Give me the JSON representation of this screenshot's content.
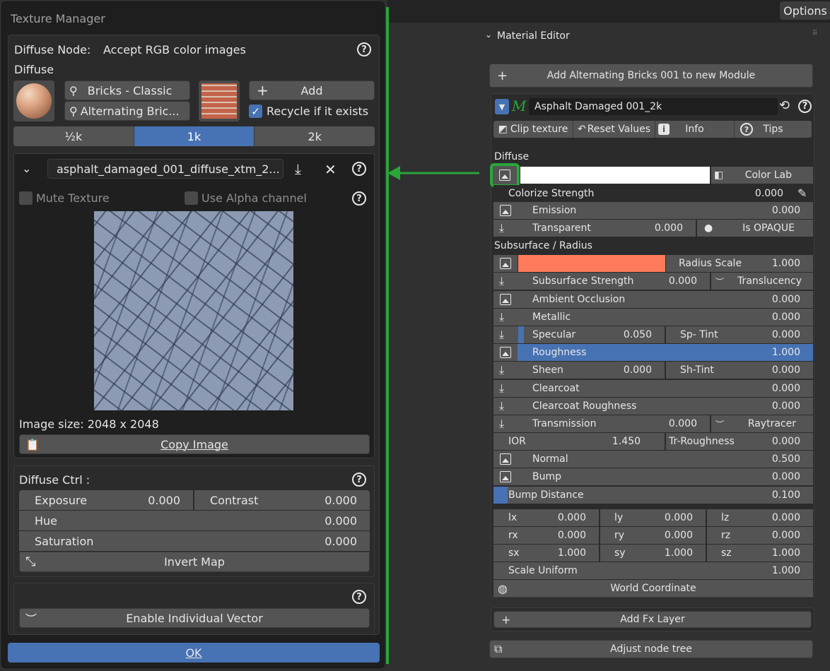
{
  "topbar": {
    "options_label": "Options"
  },
  "texture_manager": {
    "title": "Texture Manager",
    "diffuse_node_label": "Diffuse Node:",
    "diffuse_node_desc": "Accept RGB color images",
    "diffuse_label": "Diffuse",
    "preset_name": "Bricks - Classic",
    "preset_variant": "Alternating Bric...",
    "add_label": "Add",
    "recycle_label": "Recycle if it exists",
    "recycle_checked": true,
    "resolutions": [
      "½k",
      "1k",
      "2k"
    ],
    "selected_resolution": "1k",
    "file_name": "asphalt_damaged_001_diffuse_xtm_2...",
    "mute_label": "Mute Texture",
    "alpha_label": "Use Alpha channel",
    "image_size": "Image size: 2048 x 2048",
    "copy_label": "Copy Image",
    "ctrl_title": "Diffuse Ctrl :",
    "exposure_label": "Exposure",
    "exposure_value": "0.000",
    "contrast_label": "Contrast",
    "contrast_value": "0.000",
    "hue_label": "Hue",
    "hue_value": "0.000",
    "saturation_label": "Saturation",
    "saturation_value": "0.000",
    "invert_label": "Invert Map",
    "vector_label": "Enable Individual Vector",
    "ok_label": "OK"
  },
  "material_editor": {
    "title": "Material Editor",
    "add_module_label": "Add Alternating Bricks 001 to new Module",
    "material_name": "Asphalt Damaged 001_2k",
    "clip_label": "Clip texture",
    "reset_label": "Reset Values",
    "info_label": "Info",
    "tips_label": "Tips",
    "diffuse_section": "Diffuse",
    "color_lab_label": "Color Lab",
    "colorize_label": "Colorize Strength",
    "colorize_value": "0.000",
    "emission_label": "Emission",
    "emission_value": "0.000",
    "transparent_label": "Transparent",
    "transparent_value": "0.000",
    "opaque_label": "Is OPAQUE",
    "subsurface_section": "Subsurface / Radius",
    "subsurface_color": "#ff7b5c",
    "radius_scale_label": "Radius Scale",
    "radius_scale_value": "1.000",
    "sss_strength_label": "Subsurface Strength",
    "sss_strength_value": "0.000",
    "translucency_label": "Translucency",
    "ao_label": "Ambient Occlusion",
    "ao_value": "0.000",
    "metallic_label": "Metallic",
    "metallic_value": "0.000",
    "specular_label": "Specular",
    "specular_value": "0.050",
    "sp_tint_label": "Sp- Tint",
    "sp_tint_value": "0.000",
    "roughness_label": "Roughness",
    "roughness_value": "1.000",
    "sheen_label": "Sheen",
    "sheen_value": "0.000",
    "sh_tint_label": "Sh-Tint",
    "sh_tint_value": "0.000",
    "clearcoat_label": "Clearcoat",
    "clearcoat_value": "0.000",
    "cc_rough_label": "Clearcoat Roughness",
    "cc_rough_value": "0.000",
    "transmission_label": "Transmission",
    "transmission_value": "0.000",
    "raytracer_label": "Raytracer",
    "ior_label": "IOR",
    "ior_value": "1.450",
    "tr_rough_label": "Tr-Roughness",
    "tr_rough_value": "0.000",
    "normal_label": "Normal",
    "normal_value": "0.500",
    "bump_label": "Bump",
    "bump_value": "0.000",
    "bump_dist_label": "Bump Distance",
    "bump_dist_value": "0.100",
    "lx_label": "lx",
    "lx_value": "0.000",
    "ly_label": "ly",
    "ly_value": "0.000",
    "lz_label": "lz",
    "lz_value": "0.000",
    "rx_label": "rx",
    "rx_value": "0.000",
    "ry_label": "ry",
    "ry_value": "0.000",
    "rz_label": "rz",
    "rz_value": "0.000",
    "sx_label": "sx",
    "sx_value": "1.000",
    "sy_label": "sy",
    "sy_value": "1.000",
    "sz_label": "sz",
    "sz_value": "1.000",
    "scale_uniform_label": "Scale Uniform",
    "scale_uniform_value": "1.000",
    "world_coord_label": "World Coordinate",
    "add_fx_label": "Add Fx Layer",
    "adjust_label": "Adjust node tree"
  },
  "colors": {
    "accent": "#4772b3",
    "highlight": "#2aa63a",
    "subsurface": "#ff7b5c"
  }
}
